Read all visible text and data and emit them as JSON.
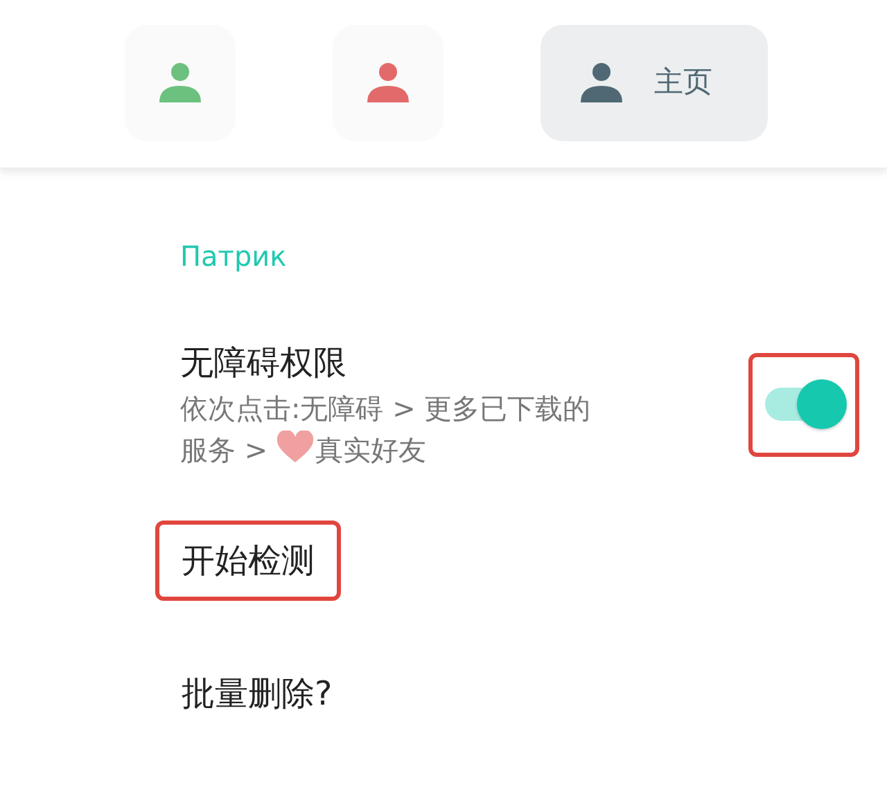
{
  "tabs": [
    {
      "color": "#6cc17f",
      "selected": false
    },
    {
      "color": "#e26a6a",
      "selected": false
    },
    {
      "color": "#4f6874",
      "label": "主页",
      "selected": true
    }
  ],
  "section": {
    "title": "Патрик"
  },
  "items": [
    {
      "kind": "toggle",
      "title": "无障碍权限",
      "description_line_1": "依次点击:无障碍 > 更多已下载的",
      "description_before": "服务 > ",
      "description_after": "真实好友",
      "on": true,
      "annotated": true
    },
    {
      "kind": "action",
      "title": "开始检测",
      "annotated": true
    },
    {
      "kind": "action",
      "title": "批量删除?",
      "annotated": false
    }
  ]
}
